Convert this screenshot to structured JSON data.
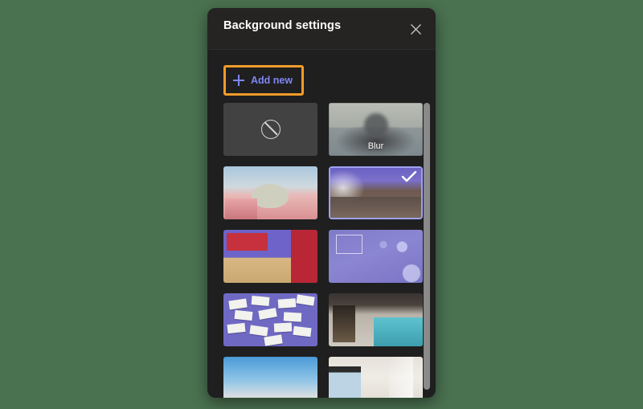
{
  "desktop": {
    "background_color": "#4a7150"
  },
  "panel": {
    "title": "Background settings",
    "background_color": "#1f1f1f",
    "header_background_color": "#252423",
    "close_icon": "close-icon"
  },
  "add_new": {
    "label": "Add new",
    "icon": "plus-icon",
    "accent_color": "#7f85f5",
    "focus_ring_color": "#f59b29"
  },
  "gallery": {
    "selected_index": 3,
    "selected_border_color": "#9ea2f0",
    "check_icon": "check-icon",
    "items": [
      {
        "name": "none",
        "label": "",
        "art": "none-art",
        "icon": "no-background-icon"
      },
      {
        "name": "blur",
        "label": "Blur",
        "art": "blur-art"
      },
      {
        "name": "circus-illustration",
        "label": "",
        "art": "art-circus"
      },
      {
        "name": "purple-living-room",
        "label": "",
        "art": "art-livingroom"
      },
      {
        "name": "library-shelf",
        "label": "",
        "art": "art-library"
      },
      {
        "name": "purple-bubbles",
        "label": "",
        "art": "art-bubbles"
      },
      {
        "name": "sticky-notes-wall",
        "label": "",
        "art": "art-stickies"
      },
      {
        "name": "office-lockers",
        "label": "",
        "art": "art-office"
      },
      {
        "name": "sky-horizon",
        "label": "",
        "art": "art-sky"
      },
      {
        "name": "white-room",
        "label": "",
        "art": "art-whiteroom"
      }
    ]
  },
  "scrollbar": {
    "thumb_color": "#8a8a8a"
  }
}
